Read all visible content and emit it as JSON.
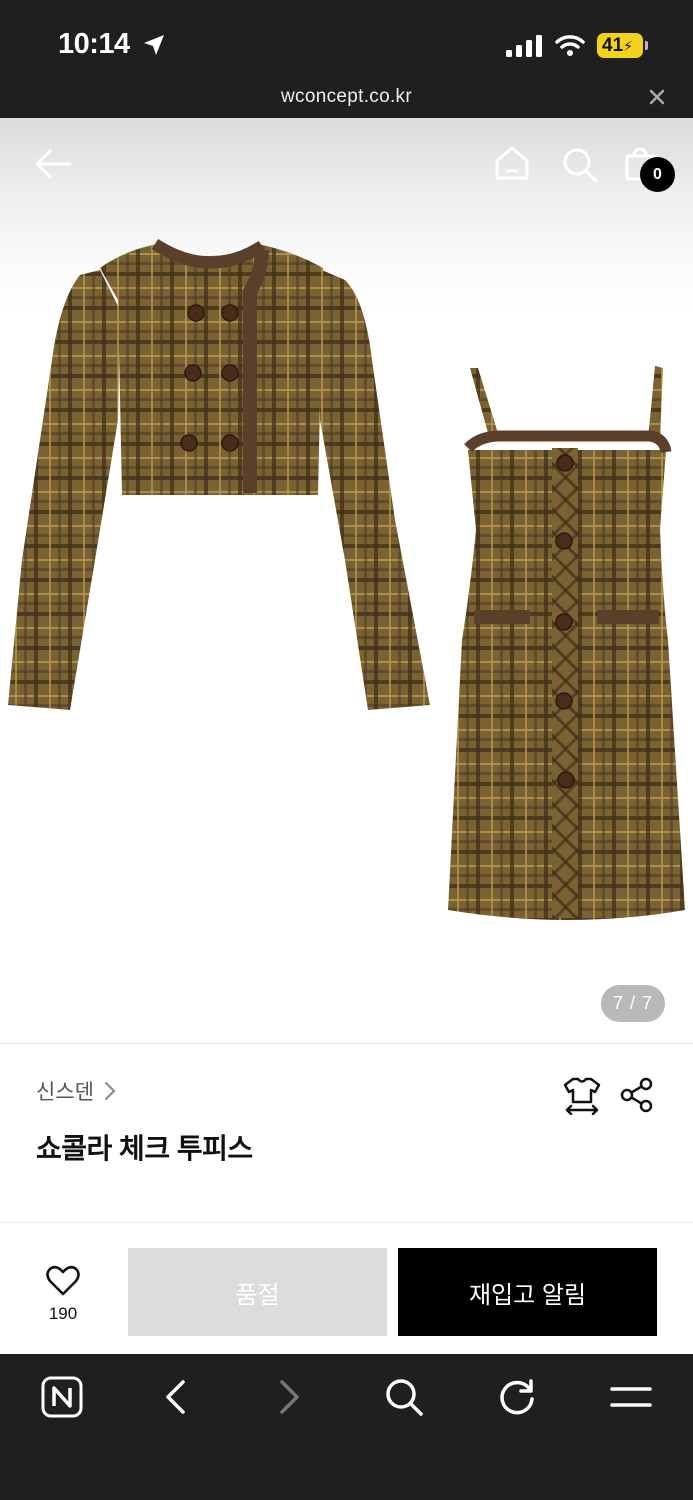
{
  "status_bar": {
    "time": "10:14",
    "battery": "41",
    "url": "wconcept.co.kr"
  },
  "header": {
    "cart_count": "0"
  },
  "gallery": {
    "indicator": "7 / 7"
  },
  "product": {
    "brand": "신스덴",
    "title": "쇼콜라 체크 투피스"
  },
  "actions": {
    "like_count": "190",
    "soldout_label": "품절",
    "restock_label": "재입고 알림"
  },
  "colors": {
    "tweed": "#7a6233",
    "trim": "#5a3f2a",
    "status_bg": "#1f1f1f",
    "battery": "#f2d21b"
  },
  "icons": [
    "location-arrow-icon",
    "signal-icon",
    "wifi-icon",
    "close-icon",
    "back-arrow-icon",
    "home-icon",
    "search-icon",
    "cart-icon",
    "size-guide-icon",
    "share-icon",
    "heart-icon",
    "naver-icon",
    "chevron-left-icon",
    "chevron-right-icon",
    "refresh-icon",
    "menu-icon"
  ]
}
